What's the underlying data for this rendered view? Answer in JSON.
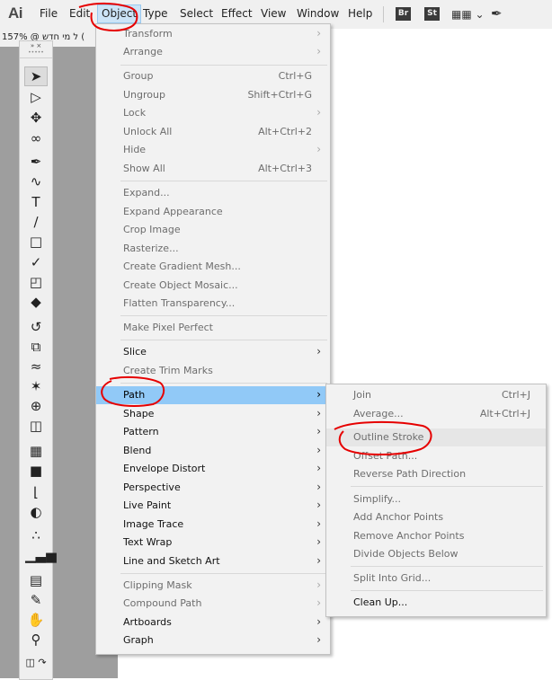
{
  "app": {
    "logo": "Ai"
  },
  "menubar": {
    "items": [
      "File",
      "Edit",
      "Object",
      "Type",
      "Select",
      "Effect",
      "View",
      "Window",
      "Help"
    ],
    "active": "Object",
    "badges": [
      "Br",
      "St"
    ],
    "workspace_icon": "grid-dropdown-icon",
    "brush_icon": "brush-icon"
  },
  "document": {
    "tab_label": "ל מי חדש @ 157% ("
  },
  "colors": {
    "menu_bg": "#f2f2f2",
    "highlight": "#91c9f7",
    "disabled_text": "#6d6d6d",
    "annotation": "#e60000"
  },
  "tools": [
    "selection-tool-icon",
    "direct-selection-tool-icon",
    "magic-wand-icon",
    "lasso-icon",
    "pen-tool-icon",
    "curvature-tool-icon",
    "type-tool-icon",
    "line-tool-icon",
    "rectangle-tool-icon",
    "paintbrush-icon",
    "shaper-tool-icon",
    "eraser-icon",
    "rotate-tool-icon",
    "scale-tool-icon",
    "warp-tool-icon",
    "puppet-warp-icon",
    "shape-builder-icon",
    "perspective-grid-icon",
    "mesh-tool-icon",
    "gradient-tool-icon",
    "eyedropper-icon",
    "blend-tool-icon",
    "symbol-sprayer-icon",
    "column-graph-icon",
    "artboard-tool-icon",
    "slice-tool-icon",
    "hand-tool-icon",
    "zoom-tool-icon",
    "swap-fill-stroke-icon"
  ],
  "object_menu": {
    "items": [
      {
        "label": "Transform",
        "shortcut": "",
        "submenu": true,
        "enabled": false
      },
      {
        "label": "Arrange",
        "shortcut": "",
        "submenu": true,
        "enabled": false
      },
      {
        "label": "Group",
        "shortcut": "Ctrl+G",
        "submenu": false,
        "enabled": false
      },
      {
        "label": "Ungroup",
        "shortcut": "Shift+Ctrl+G",
        "submenu": false,
        "enabled": false
      },
      {
        "label": "Lock",
        "shortcut": "",
        "submenu": true,
        "enabled": false
      },
      {
        "label": "Unlock All",
        "shortcut": "Alt+Ctrl+2",
        "submenu": false,
        "enabled": false
      },
      {
        "label": "Hide",
        "shortcut": "",
        "submenu": true,
        "enabled": false
      },
      {
        "label": "Show All",
        "shortcut": "Alt+Ctrl+3",
        "submenu": false,
        "enabled": false
      },
      {
        "label": "Expand...",
        "shortcut": "",
        "submenu": false,
        "enabled": false
      },
      {
        "label": "Expand Appearance",
        "shortcut": "",
        "submenu": false,
        "enabled": false
      },
      {
        "label": "Crop Image",
        "shortcut": "",
        "submenu": false,
        "enabled": false
      },
      {
        "label": "Rasterize...",
        "shortcut": "",
        "submenu": false,
        "enabled": false
      },
      {
        "label": "Create Gradient Mesh...",
        "shortcut": "",
        "submenu": false,
        "enabled": false
      },
      {
        "label": "Create Object Mosaic...",
        "shortcut": "",
        "submenu": false,
        "enabled": false
      },
      {
        "label": "Flatten Transparency...",
        "shortcut": "",
        "submenu": false,
        "enabled": false
      },
      {
        "label": "Make Pixel Perfect",
        "shortcut": "",
        "submenu": false,
        "enabled": false
      },
      {
        "label": "Slice",
        "shortcut": "",
        "submenu": true,
        "enabled": true
      },
      {
        "label": "Create Trim Marks",
        "shortcut": "",
        "submenu": false,
        "enabled": false
      },
      {
        "label": "Path",
        "shortcut": "",
        "submenu": true,
        "enabled": true,
        "highlighted": true
      },
      {
        "label": "Shape",
        "shortcut": "",
        "submenu": true,
        "enabled": true
      },
      {
        "label": "Pattern",
        "shortcut": "",
        "submenu": true,
        "enabled": true
      },
      {
        "label": "Blend",
        "shortcut": "",
        "submenu": true,
        "enabled": true
      },
      {
        "label": "Envelope Distort",
        "shortcut": "",
        "submenu": true,
        "enabled": true
      },
      {
        "label": "Perspective",
        "shortcut": "",
        "submenu": true,
        "enabled": true
      },
      {
        "label": "Live Paint",
        "shortcut": "",
        "submenu": true,
        "enabled": true
      },
      {
        "label": "Image Trace",
        "shortcut": "",
        "submenu": true,
        "enabled": true
      },
      {
        "label": "Text Wrap",
        "shortcut": "",
        "submenu": true,
        "enabled": true
      },
      {
        "label": "Line and Sketch Art",
        "shortcut": "",
        "submenu": true,
        "enabled": true
      },
      {
        "label": "Clipping Mask",
        "shortcut": "",
        "submenu": true,
        "enabled": false
      },
      {
        "label": "Compound Path",
        "shortcut": "",
        "submenu": true,
        "enabled": false
      },
      {
        "label": "Artboards",
        "shortcut": "",
        "submenu": true,
        "enabled": true
      },
      {
        "label": "Graph",
        "shortcut": "",
        "submenu": true,
        "enabled": true
      }
    ]
  },
  "path_submenu": {
    "items": [
      {
        "label": "Join",
        "shortcut": "Ctrl+J",
        "enabled": false
      },
      {
        "label": "Average...",
        "shortcut": "Alt+Ctrl+J",
        "enabled": false
      },
      {
        "label": "Outline Stroke",
        "shortcut": "",
        "enabled": false,
        "hovered": true
      },
      {
        "label": "Offset Path...",
        "shortcut": "",
        "enabled": false
      },
      {
        "label": "Reverse Path Direction",
        "shortcut": "",
        "enabled": false
      },
      {
        "label": "Simplify...",
        "shortcut": "",
        "enabled": false
      },
      {
        "label": "Add Anchor Points",
        "shortcut": "",
        "enabled": false
      },
      {
        "label": "Remove Anchor Points",
        "shortcut": "",
        "enabled": false
      },
      {
        "label": "Divide Objects Below",
        "shortcut": "",
        "enabled": false
      },
      {
        "label": "Split Into Grid...",
        "shortcut": "",
        "enabled": false
      },
      {
        "label": "Clean Up...",
        "shortcut": "",
        "enabled": true
      }
    ]
  }
}
